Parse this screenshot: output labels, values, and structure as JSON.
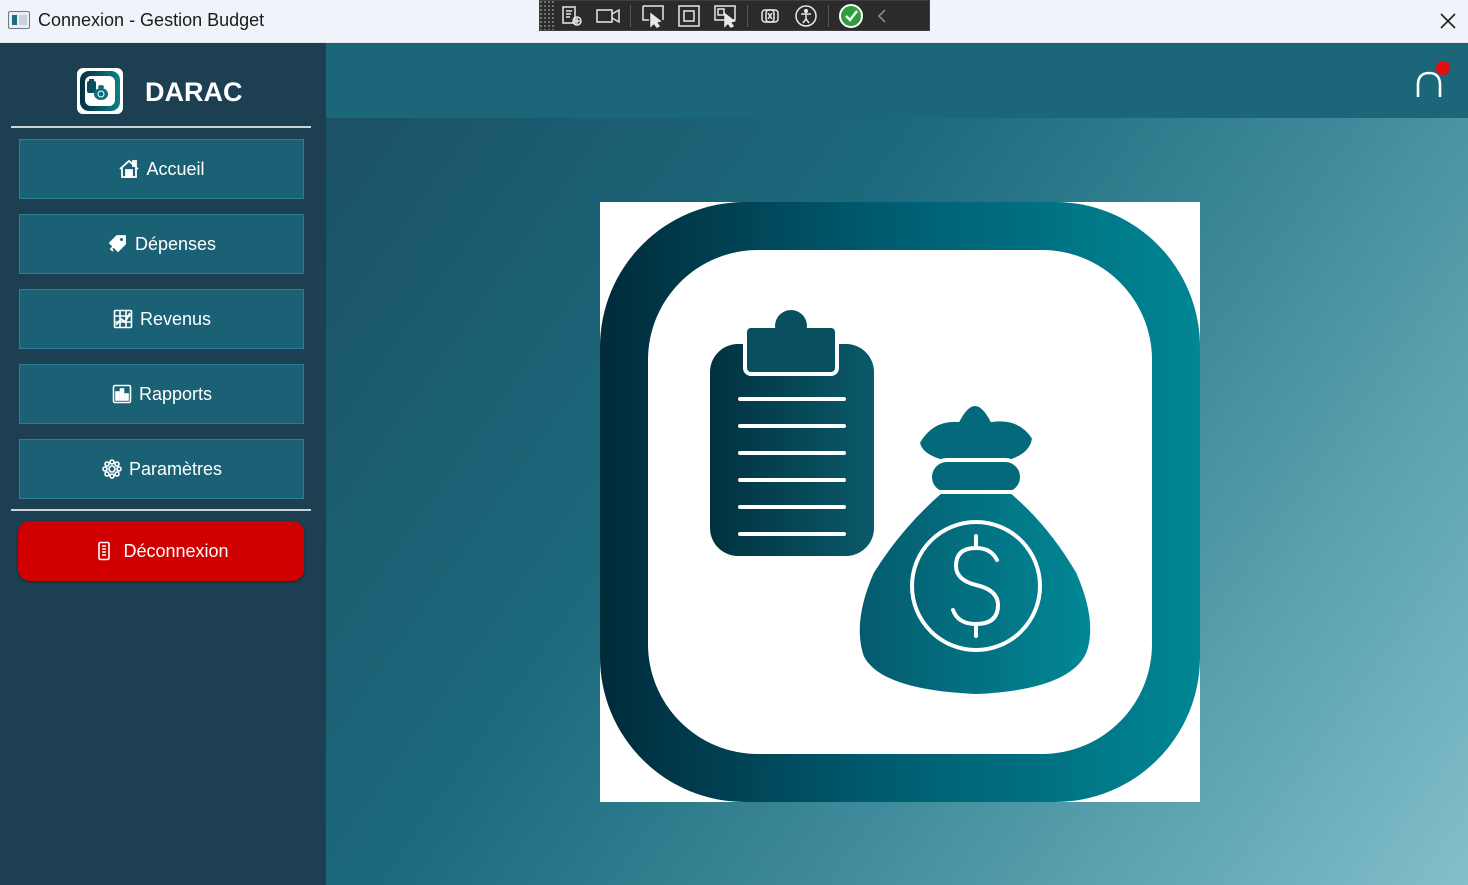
{
  "window": {
    "title": "Connexion - Gestion Budget",
    "close_label": "Close"
  },
  "debug_toolbar": {
    "tools": [
      "live-visual-tree-icon",
      "record-icon",
      "select-element-icon",
      "display-layout-adorners-icon",
      "track-focused-element-icon",
      "binding-failures-icon",
      "accessibility-icon",
      "check-icon",
      "collapse-chevron-icon"
    ]
  },
  "sidebar": {
    "brand": "DARAC",
    "nav": [
      {
        "label": "Accueil",
        "icon": "home-icon"
      },
      {
        "label": "Dépenses",
        "icon": "tag-icon"
      },
      {
        "label": "Revenus",
        "icon": "chart-grid-icon"
      },
      {
        "label": "Rapports",
        "icon": "bar-chart-icon"
      },
      {
        "label": "Paramètres",
        "icon": "gear-icon"
      }
    ],
    "logout": {
      "label": "Déconnexion",
      "icon": "door-icon"
    }
  },
  "main": {
    "notification_icon": "bell-icon",
    "has_notification": true,
    "hero_image": "budget-logo-clipboard-moneybag"
  },
  "colors": {
    "sidebar_bg": "#1c3f52",
    "nav_button_bg": "#1b6175",
    "logout_bg": "#d00000",
    "topbar_bg": "#1b6678",
    "notification_dot": "#e10e0e"
  }
}
